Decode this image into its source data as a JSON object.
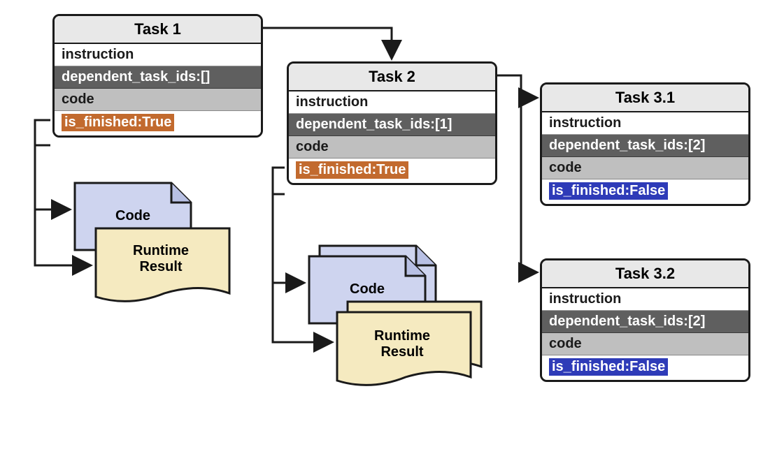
{
  "tasks": [
    {
      "title": "Task 1",
      "instruction": "instruction",
      "deps": "dependent_task_ids:[]",
      "code": "code",
      "status": "is_finished:True",
      "finished": true
    },
    {
      "title": "Task 2",
      "instruction": "instruction",
      "deps": "dependent_task_ids:[1]",
      "code": "code",
      "status": "is_finished:True",
      "finished": true
    },
    {
      "title": "Task 3.1",
      "instruction": "instruction",
      "deps": "dependent_task_ids:[2]",
      "code": "code",
      "status": "is_finished:False",
      "finished": false
    },
    {
      "title": "Task 3.2",
      "instruction": "instruction",
      "deps": "dependent_task_ids:[2]",
      "code": "code",
      "status": "is_finished:False",
      "finished": false
    }
  ],
  "labels": {
    "code": "Code",
    "runtime": "Runtime Result"
  }
}
